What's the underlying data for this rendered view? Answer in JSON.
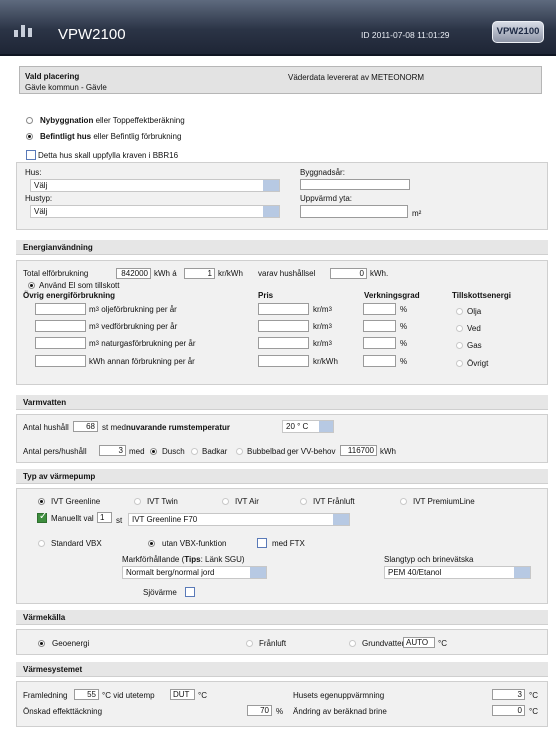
{
  "header": {
    "app_title": "VPW2100",
    "id_text": "ID 2011-07-08 11:01:29",
    "logo_text": "VPW2100",
    "bg_color": "#2b3446"
  },
  "location": {
    "title": "Vald placering",
    "place": "Gävle kommun - Gävle",
    "weather_source": "Väderdata levererat av METEONORM"
  },
  "building_mode": {
    "new_build_bold": "Nybyggnation",
    "new_build_rest": "eller Toppeffektberäkning",
    "existing_bold": "Befintligt hus",
    "existing_rest": "eller Befintlig förbrukning",
    "bbr_label": "Detta hus skall uppfylla kraven i BBR16",
    "hus_label": "Hus:",
    "hus_value": "Välj",
    "hustyp_label": "Hustyp:",
    "hustyp_value": "Välj",
    "byggnadsar_label": "Byggnadsår:",
    "byggnadsar_value": "",
    "uppvarmd_label": "Uppvärmd yta:",
    "uppvarmd_value": "",
    "area_unit": "m²"
  },
  "energy": {
    "section_title": "Energianvändning",
    "total_label": "Total elförbrukning",
    "total_value": "842000",
    "kwh_a": "kWh á",
    "price_value": "1",
    "price_unit": "kr/kWh",
    "varav_label": "varav hushållsel",
    "household_value": "0",
    "kwh_dot": "kWh.",
    "use_el_label": "Använd El som tillskott",
    "col_ovrig": "Övrig energiförbrukning",
    "col_pris": "Pris",
    "col_verk": "Verkningsgrad",
    "col_tillsk": "Tillskottsenergi",
    "rows": [
      {
        "unit": "m",
        "desc": "oljeförbrukning per år",
        "pris_unit": "kr/m",
        "tillsk": "Olja"
      },
      {
        "unit": "m",
        "desc": "vedförbrukning per år",
        "pris_unit": "kr/m",
        "tillsk": "Ved"
      },
      {
        "unit": "m",
        "desc": "naturgasförbrukning per år",
        "pris_unit": "kr/m",
        "tillsk": "Gas"
      },
      {
        "unit": "kWh",
        "desc": "annan förbrukning per år",
        "pris_unit": "kr/kWh",
        "tillsk": "Övrigt"
      }
    ],
    "pct": "%",
    "cubed": "3"
  },
  "hotwater": {
    "section_title": "Varmvatten",
    "antal_hushall_label": "Antal hushåll",
    "antal_hushall_value": "68",
    "st_med": "st med",
    "nuvarande_label": "nuvarande rumstemperatur",
    "temp_value": "20 ° C",
    "pers_label": "Antal pers/hushåll",
    "pers_value": "3",
    "med": "med",
    "dusch": "Dusch",
    "badkar": "Badkar",
    "bubbelbad": "Bubbelbad",
    "ger_label": "ger VV-behov",
    "vv_value": "116700",
    "kwh": "kWh"
  },
  "heatpump": {
    "section_title": "Typ av värmepump",
    "options": [
      "IVT Greenline",
      "IVT Twin",
      "IVT Air",
      "IVT Frånluft",
      "IVT PremiumLine"
    ],
    "manuellt_label": "Manuellt val",
    "manuellt_count": "1",
    "st": "st",
    "model_value": "IVT Greenline F70",
    "standard_vbx": "Standard VBX",
    "utan_vbx": "utan VBX-funktion",
    "med_ftx": "med FTX",
    "mark_label_pre": "Markförhållande (",
    "mark_label_tips": "Tips",
    "mark_label_post": ": Länk SGU)",
    "mark_value": "Normalt berg/normal jord",
    "slang_label": "Slangtyp och brinevätska",
    "slang_value": "PEM 40/Etanol",
    "sjovarme": "Sjövärme"
  },
  "heatsource": {
    "section_title": "Värmekälla",
    "geo": "Geoenergi",
    "franluft": "Frånluft",
    "grund": "Grundvatten",
    "grund_value": "AUTO",
    "unit": "°C"
  },
  "system": {
    "section_title": "Värmesystemet",
    "framledning": "Framledning",
    "fram_value": "55",
    "vid_ute": "°C vid utetemp",
    "dut_value": "DUT",
    "c": "°C",
    "eget_label": "Husets egenuppvärmning",
    "eget_value": "3",
    "onskad_label": "Önskad effekttäckning",
    "onskad_value": "70",
    "percent": "%",
    "andring_label": "Ändring av beräknad brine",
    "andring_value": "0"
  }
}
